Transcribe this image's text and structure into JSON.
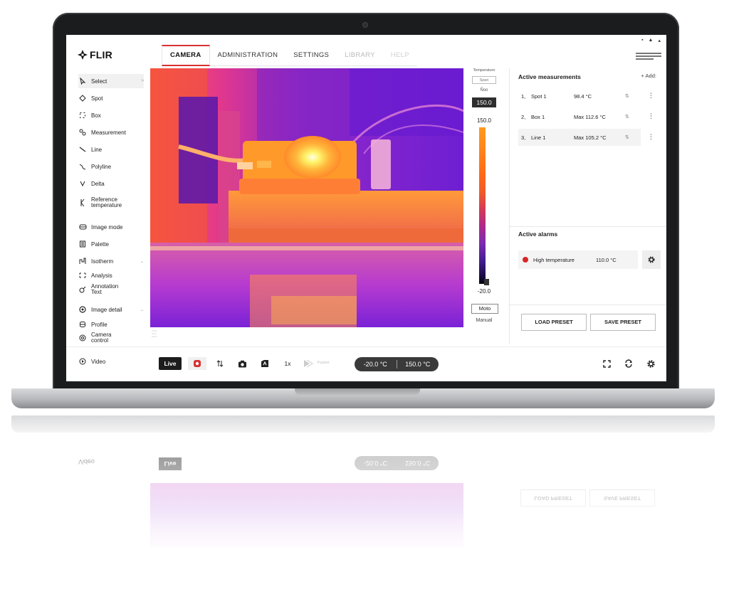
{
  "app": {
    "logo_text": "FLIR"
  },
  "tabs": [
    {
      "label": "CAMERA",
      "active": true
    },
    {
      "label": "ADMINISTRATION"
    },
    {
      "label": "SETTINGS"
    },
    {
      "label": "LIBRARY"
    },
    {
      "label": "HELP"
    }
  ],
  "sidebar": {
    "items": [
      {
        "label": "Select",
        "icon": "cursor-icon"
      },
      {
        "label": "Spot",
        "icon": "spot-icon"
      },
      {
        "label": "Box",
        "icon": "box-icon"
      },
      {
        "label": "Measurement",
        "icon": "measurement-icon"
      },
      {
        "label": "Line",
        "icon": "line-icon"
      },
      {
        "label": "Polyline",
        "icon": "polyline-icon"
      },
      {
        "label": "Delta",
        "icon": "delta-icon"
      },
      {
        "label": "Reference",
        "label2": "temperature",
        "icon": "reference-icon"
      },
      {
        "label": "Image mode",
        "icon": "image-mode-icon"
      },
      {
        "label": "Palette",
        "icon": "palette-icon"
      },
      {
        "label": "Isotherm",
        "icon": "isotherm-icon"
      },
      {
        "label": "Analysis",
        "icon": "analysis-icon"
      },
      {
        "label": "Annotation",
        "label2": "Text",
        "icon": "annotation-icon"
      },
      {
        "label": "Image detail",
        "icon": "image-detail-icon"
      },
      {
        "label": "Profile",
        "icon": "profile-icon"
      },
      {
        "label": "Camera",
        "label2": "control",
        "icon": "camera-control-icon"
      }
    ],
    "video_label": "Video"
  },
  "scale": {
    "title": "Temperature",
    "small_box": "Span",
    "step_label": "Ñoo",
    "max_box": "150.0",
    "max_value": "150.0",
    "min_value": "-20.0",
    "mode_button": "Moto",
    "manual_label": "Manual"
  },
  "measurements": {
    "title": "Active measurements",
    "add_label": "Add",
    "rows": [
      {
        "num": "1,",
        "name": "Spot 1",
        "value": "98.4 °C"
      },
      {
        "num": "2,",
        "name": "Box 1",
        "value": "Max 112.6 °C"
      },
      {
        "num": "3,",
        "name": "Line 1",
        "value": "Max 105.2 °C"
      }
    ]
  },
  "alarms": {
    "title": "Active alarms",
    "rows": [
      {
        "name": "High temperature",
        "value": "110.0 °C",
        "color": "#d92525"
      }
    ]
  },
  "presets": {
    "load": "LOAD PRESET",
    "save": "SAVE PRESET"
  },
  "toolbar": {
    "live": "Live",
    "zoom": "1x",
    "fusion": "Fusion",
    "range_min": "-20.0 °C",
    "range_max": "150.0 °C"
  },
  "colors": {
    "accent_red": "#d83030",
    "alarm_red": "#d92525",
    "live_bg": "#1c1c1c"
  }
}
